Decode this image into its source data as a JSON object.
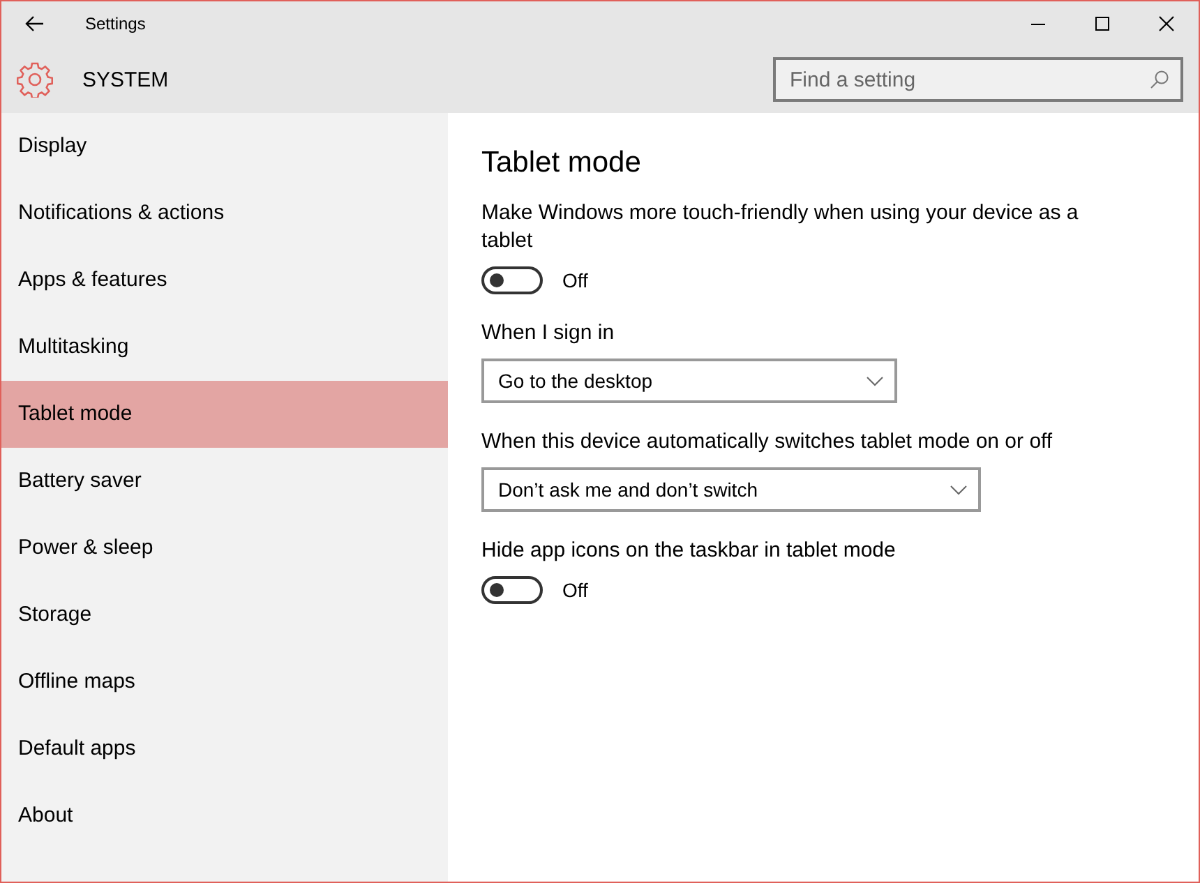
{
  "window": {
    "title": "Settings"
  },
  "header": {
    "title": "SYSTEM",
    "search": {
      "placeholder": "Find a setting"
    }
  },
  "sidebar": {
    "items": [
      {
        "label": "Display",
        "selected": false
      },
      {
        "label": "Notifications & actions",
        "selected": false
      },
      {
        "label": "Apps & features",
        "selected": false
      },
      {
        "label": "Multitasking",
        "selected": false
      },
      {
        "label": "Tablet mode",
        "selected": true
      },
      {
        "label": "Battery saver",
        "selected": false
      },
      {
        "label": "Power & sleep",
        "selected": false
      },
      {
        "label": "Storage",
        "selected": false
      },
      {
        "label": "Offline maps",
        "selected": false
      },
      {
        "label": "Default apps",
        "selected": false
      },
      {
        "label": "About",
        "selected": false
      }
    ]
  },
  "content": {
    "title": "Tablet mode",
    "settings": [
      {
        "kind": "toggle",
        "label": "Make Windows more touch-friendly when using your device as a tablet",
        "on": false,
        "state_text": "Off"
      },
      {
        "kind": "dropdown",
        "label": "When I sign in",
        "value": "Go to the desktop"
      },
      {
        "kind": "dropdown",
        "label": "When this device automatically switches tablet mode on or off",
        "value": "Don’t ask me and don’t switch"
      },
      {
        "kind": "toggle",
        "label": "Hide app icons on the taskbar in tablet mode",
        "on": false,
        "state_text": "Off"
      }
    ]
  }
}
